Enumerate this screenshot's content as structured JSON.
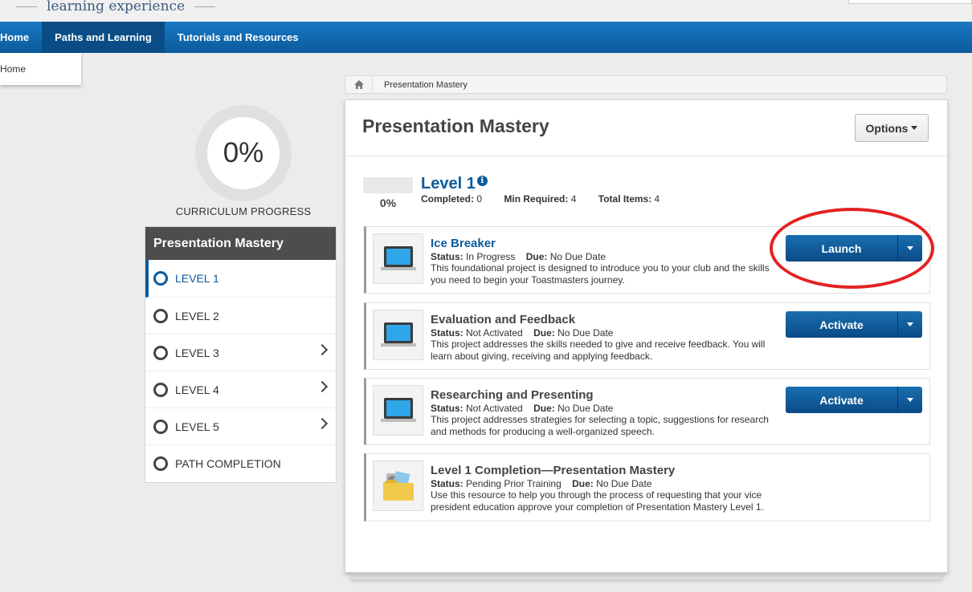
{
  "header": {
    "brand_text": "learning experience"
  },
  "nav": {
    "items": [
      {
        "label": "Home"
      },
      {
        "label": "Paths and Learning"
      },
      {
        "label": "Tutorials and Resources"
      }
    ],
    "dropdown_item": "Home"
  },
  "breadcrumb": {
    "current": "Presentation Mastery"
  },
  "progress": {
    "value": "0%",
    "label": "CURRICULUM PROGRESS"
  },
  "sidebar": {
    "title": "Presentation Mastery",
    "items": [
      {
        "label": "LEVEL 1",
        "active": true,
        "has_chevron": false
      },
      {
        "label": "LEVEL 2",
        "active": false,
        "has_chevron": false
      },
      {
        "label": "LEVEL 3",
        "active": false,
        "has_chevron": true
      },
      {
        "label": "LEVEL 4",
        "active": false,
        "has_chevron": true
      },
      {
        "label": "LEVEL 5",
        "active": false,
        "has_chevron": true
      },
      {
        "label": "PATH COMPLETION",
        "active": false,
        "has_chevron": false
      }
    ]
  },
  "main": {
    "title": "Presentation Mastery",
    "options_label": "Options",
    "level": {
      "title": "Level 1",
      "percent": "0%",
      "completed_label": "Completed:",
      "completed_value": "0",
      "min_label": "Min Required:",
      "min_value": "4",
      "total_label": "Total Items:",
      "total_value": "4"
    },
    "items": [
      {
        "title": "Ice Breaker",
        "status_label": "Status:",
        "status_value": "In Progress",
        "due_label": "Due:",
        "due_value": "No Due Date",
        "description": "This foundational project is designed to introduce you to your club and the skills you need to begin your Toastmasters journey.",
        "action": "Launch",
        "icon": "laptop-icon"
      },
      {
        "title": "Evaluation and Feedback",
        "status_label": "Status:",
        "status_value": "Not Activated",
        "due_label": "Due:",
        "due_value": "No Due Date",
        "description": "This project addresses the skills needed to give and receive feedback. You will learn about giving, receiving and applying feedback.",
        "action": "Activate",
        "icon": "laptop-icon"
      },
      {
        "title": "Researching and Presenting",
        "status_label": "Status:",
        "status_value": "Not Activated",
        "due_label": "Due:",
        "due_value": "No Due Date",
        "description": "This project addresses strategies for selecting a topic, suggestions for research and methods for producing a well-organized speech.",
        "action": "Activate",
        "icon": "laptop-icon"
      },
      {
        "title": "Level 1 Completion—Presentation Mastery",
        "status_label": "Status:",
        "status_value": "Pending Prior Training",
        "due_label": "Due:",
        "due_value": "No Due Date",
        "description": "Use this resource to help you through the process of requesting that your vice president education approve your completion of Presentation Mastery Level 1.",
        "icon": "folder-icon"
      }
    ]
  },
  "colors": {
    "nav_blue": "#0b5a9c",
    "button_blue": "#0a4a86",
    "highlight_red": "#e32222",
    "sidebar_header": "#4d4d4d"
  }
}
